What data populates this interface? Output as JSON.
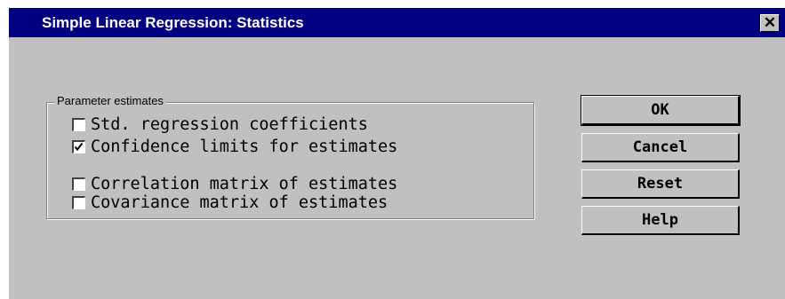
{
  "window": {
    "title": "Simple Linear Regression: Statistics",
    "close_icon": "close-icon",
    "colors": {
      "titlebar": "#000080",
      "face": "#c0c0c0"
    }
  },
  "group": {
    "label": "Parameter estimates",
    "options": [
      {
        "label": "Std. regression coefficients",
        "checked": false
      },
      {
        "label": "Confidence limits for estimates",
        "checked": true
      },
      {
        "label": "Correlation matrix of estimates",
        "checked": false
      },
      {
        "label": "Covariance matrix of estimates",
        "checked": false
      }
    ]
  },
  "buttons": {
    "ok": "OK",
    "cancel": "Cancel",
    "reset": "Reset",
    "help": "Help"
  }
}
